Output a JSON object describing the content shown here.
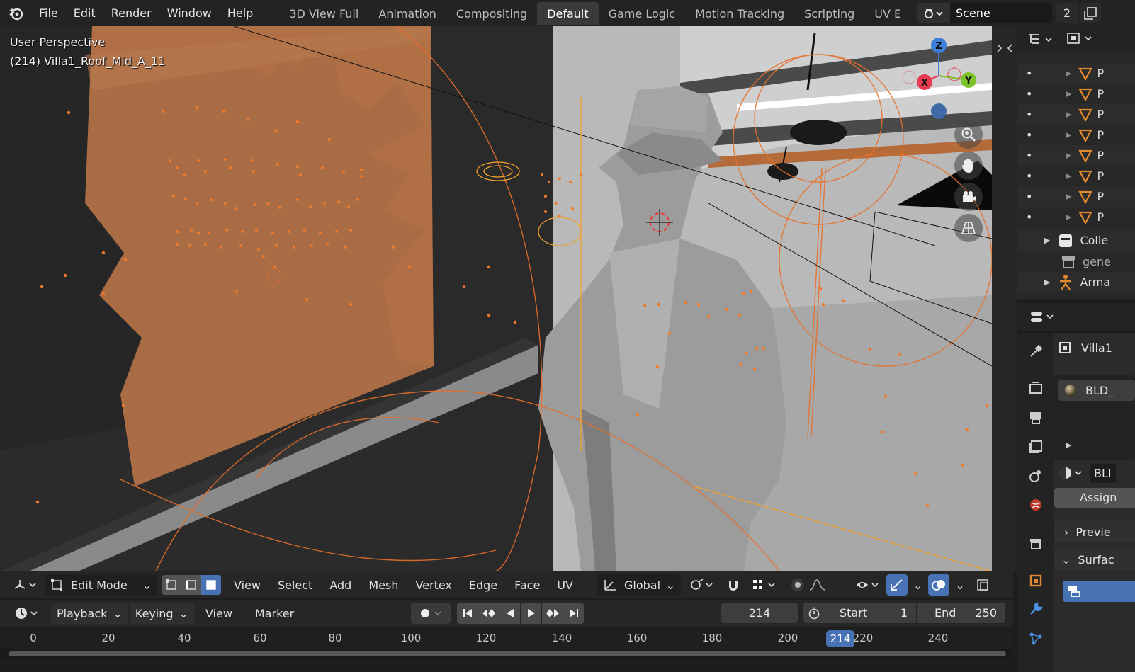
{
  "menu": {
    "items": [
      "File",
      "Edit",
      "Render",
      "Window",
      "Help"
    ]
  },
  "workspaces": {
    "tabs": [
      "3D View Full",
      "Animation",
      "Compositing",
      "Default",
      "Game Logic",
      "Motion Tracking",
      "Scripting",
      "UV E"
    ],
    "active": "Default"
  },
  "scene": {
    "name": "Scene",
    "count": "2"
  },
  "viewport": {
    "perspective": "User Perspective",
    "object_info": "(214) Villa1_Roof_Mid_A_11",
    "gizmo_axes": {
      "x": "X",
      "y": "Y",
      "z": "Z"
    }
  },
  "viewport_header": {
    "mode": "Edit Mode",
    "menus": [
      "View",
      "Select",
      "Add",
      "Mesh",
      "Vertex",
      "Edge",
      "Face",
      "UV"
    ],
    "orientation": "Global"
  },
  "timeline": {
    "menus": [
      "Playback",
      "Keying",
      "View",
      "Marker"
    ],
    "current_frame": "214",
    "start_label": "Start",
    "start_value": "1",
    "end_label": "End",
    "end_value": "250",
    "ruler_ticks": [
      "0",
      "20",
      "40",
      "60",
      "80",
      "100",
      "120",
      "140",
      "160",
      "180",
      "200",
      "220",
      "240"
    ],
    "playhead": "214"
  },
  "outliner": {
    "collection": "Colle",
    "gene": "gene",
    "armature": "Arma",
    "mesh_row_label": "P"
  },
  "properties": {
    "object_name": "Villa1",
    "material_name": "BLD_",
    "material_slot": "BLI",
    "assign_label": "Assign",
    "preview_label": "Previe",
    "surface_label": "Surfac"
  },
  "colors": {
    "accent_blue": "#4772b3",
    "selection_orange": "#e8702a",
    "x_axis": "#e83a4f",
    "y_axis": "#7cc22a",
    "z_axis": "#3f7fdc"
  }
}
